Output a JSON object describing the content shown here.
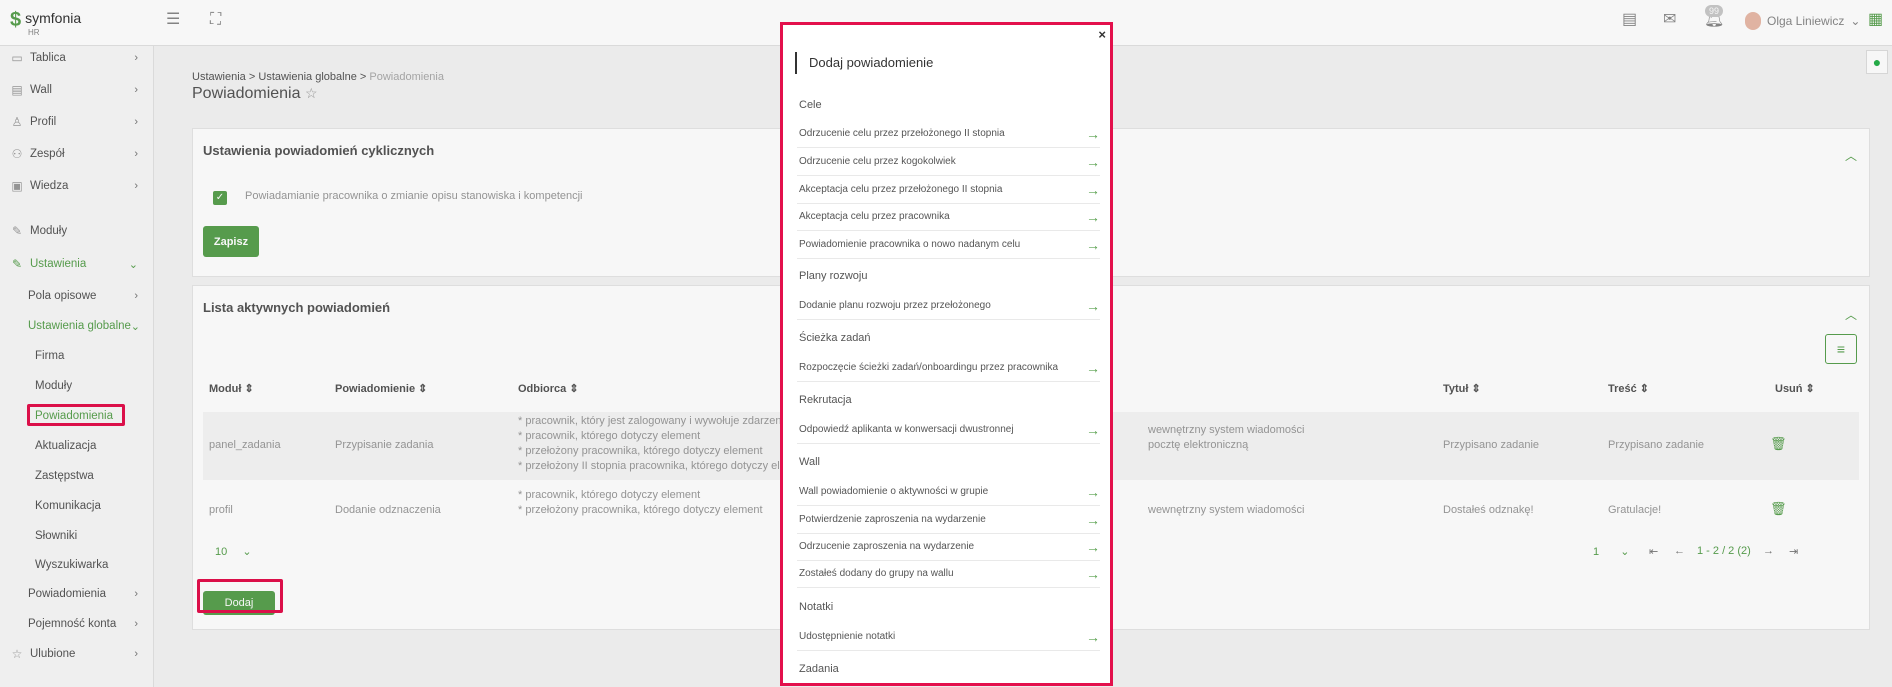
{
  "app": {
    "logo_name": "symfonia",
    "logo_sub": "HR"
  },
  "topbar": {
    "notification_count": "99",
    "user_name": "Olga Liniewicz"
  },
  "sidebar": {
    "items": [
      {
        "label": "Tablica"
      },
      {
        "label": "Wall"
      },
      {
        "label": "Profil"
      },
      {
        "label": "Zespół"
      },
      {
        "label": "Wiedza"
      },
      {
        "label": "Moduły"
      },
      {
        "label": "Ustawienia"
      },
      {
        "label": "Pola opisowe"
      },
      {
        "label": "Ustawienia globalne"
      },
      {
        "label": "Firma"
      },
      {
        "label": "Moduły"
      },
      {
        "label": "Powiadomienia"
      },
      {
        "label": "Aktualizacja"
      },
      {
        "label": "Zastępstwa"
      },
      {
        "label": "Komunikacja"
      },
      {
        "label": "Słowniki"
      },
      {
        "label": "Wyszukiwarka"
      },
      {
        "label": "Powiadomienia"
      },
      {
        "label": "Pojemność konta"
      },
      {
        "label": "Ulubione"
      }
    ]
  },
  "breadcrumb": {
    "a": "Ustawienia",
    "sep": ">",
    "b": "Ustawienia globalne",
    "c": "Powiadomienia"
  },
  "page_title": "Powiadomienia",
  "cyclic": {
    "title": "Ustawienia powiadomień cyklicznych",
    "checkbox_label": "Powiadamianie pracownika o zmianie opisu stanowiska i kompetencji",
    "save": "Zapisz"
  },
  "active": {
    "title": "Lista aktywnych powiadomień",
    "columns": {
      "module": "Moduł",
      "notification": "Powiadomienie",
      "recipient": "Odbiorca",
      "title": "Tytuł",
      "content": "Treść",
      "delete": "Usuń"
    },
    "rows": [
      {
        "module": "panel_zadania",
        "notification": "Przypisanie zadania",
        "recipients": [
          "* pracownik, który jest zalogowany i wywołuje zdarzenie",
          "* pracownik, którego dotyczy element",
          "* przełożony pracownika, którego dotyczy element",
          "* przełożony II stopnia pracownika, którego dotyczy element"
        ],
        "channels": [
          "wewnętrzny system wiadomości",
          "pocztę elektroniczną"
        ],
        "title": "Przypisano zadanie",
        "content": "Przypisano zadanie"
      },
      {
        "module": "profil",
        "notification": "Dodanie odznaczenia",
        "recipients": [
          "* pracownik, którego dotyczy element",
          "* przełożony pracownika, którego dotyczy element"
        ],
        "channels": [
          "wewnętrzny system wiadomości"
        ],
        "title": "Dostałeś odznakę!",
        "content": "Gratulacje!"
      }
    ],
    "page_size": "10",
    "page": "1",
    "range": "1 - 2 / 2 (2)",
    "add": "Dodaj"
  },
  "modal": {
    "title": "Dodaj powiadomienie",
    "close": "×",
    "groups": [
      {
        "name": "Cele",
        "items": [
          "Odrzucenie celu przez przełożonego II stopnia",
          "Odrzucenie celu przez kogokolwiek",
          "Akceptacja celu przez przełożonego II stopnia",
          "Akceptacja celu przez pracownika",
          "Powiadomienie pracownika o nowo nadanym celu"
        ]
      },
      {
        "name": "Plany rozwoju",
        "items": [
          "Dodanie planu rozwoju przez przełożonego"
        ]
      },
      {
        "name": "Ścieżka zadań",
        "items": [
          "Rozpoczęcie ścieżki zadań/onboardingu przez pracownika"
        ]
      },
      {
        "name": "Rekrutacja",
        "items": [
          "Odpowiedź aplikanta w konwersacji dwustronnej"
        ]
      },
      {
        "name": "Wall",
        "items": [
          "Wall powiadomienie o aktywności w grupie",
          "Potwierdzenie zaproszenia na wydarzenie",
          "Odrzucenie zaproszenia na wydarzenie",
          "Zostałeś dodany do grupy na wallu"
        ]
      },
      {
        "name": "Notatki",
        "items": [
          "Udostępnienie notatki"
        ]
      },
      {
        "name": "Zadania",
        "items": []
      }
    ]
  }
}
